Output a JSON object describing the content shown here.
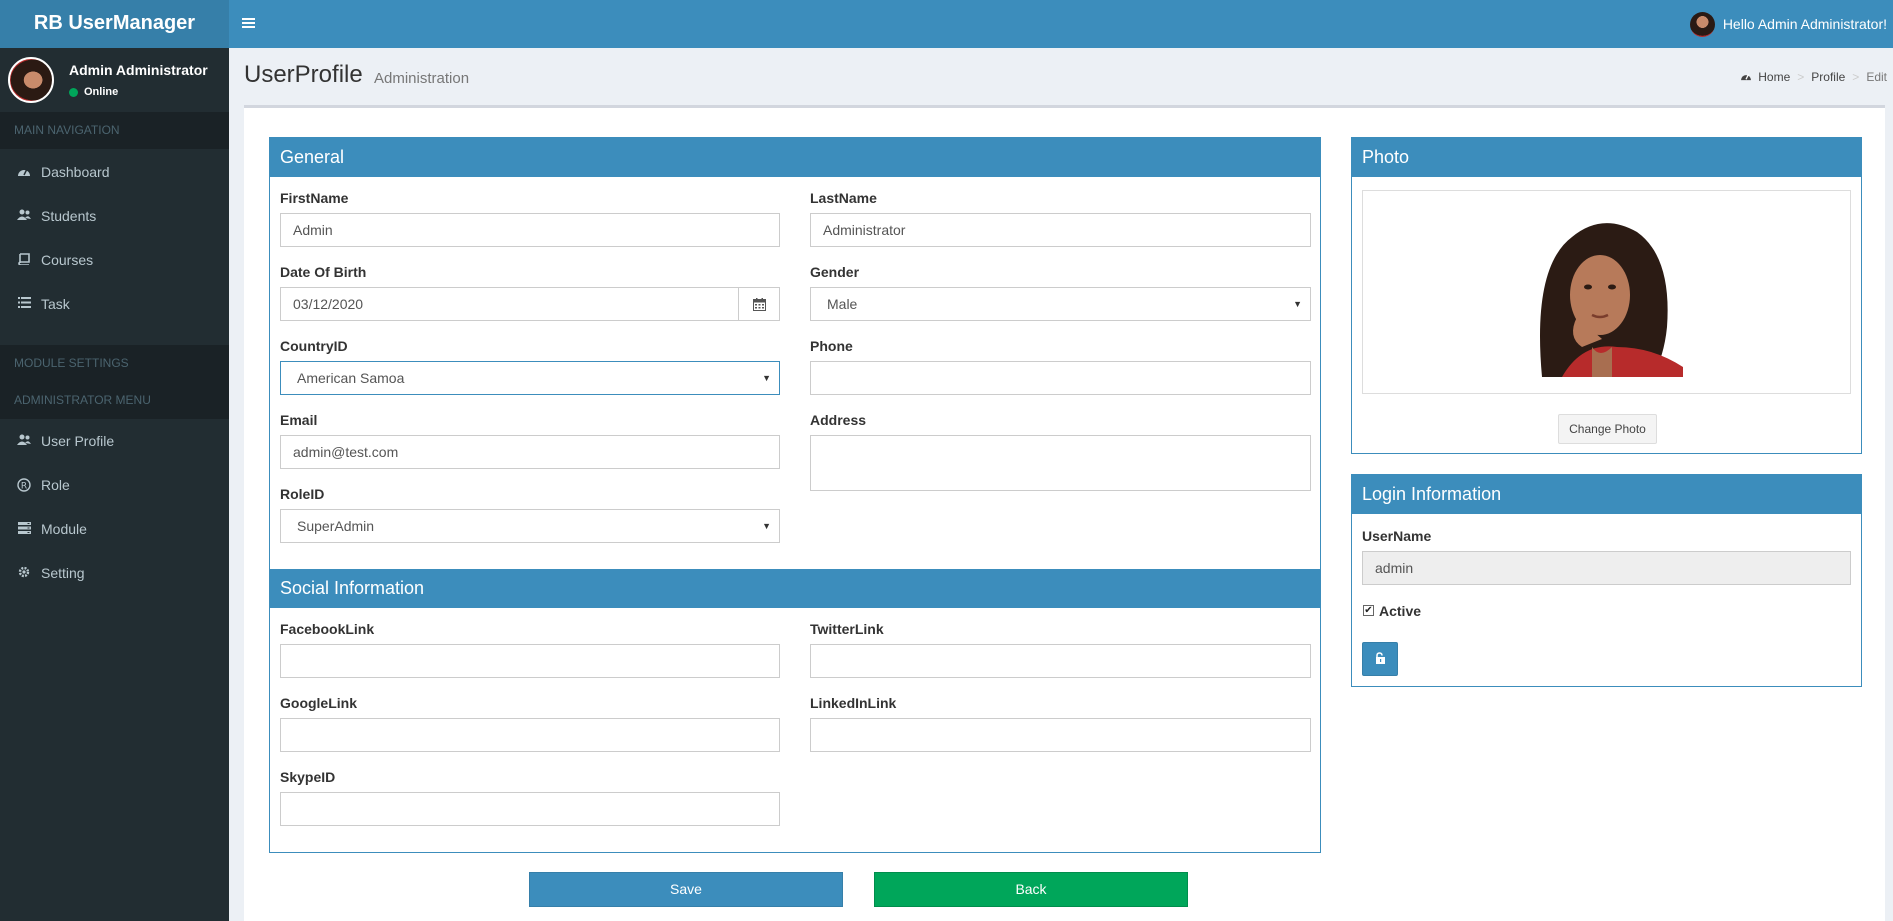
{
  "app": {
    "title": "RB UserManager",
    "greeting": "Hello Admin Administrator!"
  },
  "sidebar": {
    "user_name": "Admin Administrator",
    "user_status": "Online",
    "main_nav_header": "MAIN NAVIGATION",
    "main_items": [
      {
        "label": "Dashboard",
        "icon": "dashboard-icon"
      },
      {
        "label": "Students",
        "icon": "users-icon"
      },
      {
        "label": "Courses",
        "icon": "book-icon"
      },
      {
        "label": "Task",
        "icon": "list-icon"
      }
    ],
    "module_settings_header": "MODULE SETTINGS",
    "admin_menu_header": "ADMINISTRATOR MENU",
    "admin_items": [
      {
        "label": "User Profile",
        "icon": "users-icon"
      },
      {
        "label": "Role",
        "icon": "registered-icon"
      },
      {
        "label": "Module",
        "icon": "server-icon"
      },
      {
        "label": "Setting",
        "icon": "gear-icon"
      }
    ]
  },
  "page": {
    "title": "UserProfile",
    "subtitle": "Administration",
    "breadcrumb": [
      "Home",
      "Profile",
      "Edit"
    ]
  },
  "general": {
    "title": "General",
    "firstname_label": "FirstName",
    "firstname_value": "Admin",
    "lastname_label": "LastName",
    "lastname_value": "Administrator",
    "dob_label": "Date Of Birth",
    "dob_value": "03/12/2020",
    "gender_label": "Gender",
    "gender_value": "Male",
    "country_label": "CountryID",
    "country_value": "American Samoa",
    "phone_label": "Phone",
    "phone_value": "",
    "email_label": "Email",
    "email_value": "admin@test.com",
    "address_label": "Address",
    "address_value": "",
    "role_label": "RoleID",
    "role_value": "SuperAdmin"
  },
  "social": {
    "title": "Social Information",
    "facebook_label": "FacebookLink",
    "facebook_value": "",
    "twitter_label": "TwitterLink",
    "twitter_value": "",
    "google_label": "GoogleLink",
    "google_value": "",
    "linkedin_label": "LinkedInLink",
    "linkedin_value": "",
    "skype_label": "SkypeID",
    "skype_value": ""
  },
  "photo": {
    "title": "Photo",
    "change_label": "Change Photo"
  },
  "login": {
    "title": "Login Information",
    "username_label": "UserName",
    "username_value": "admin",
    "active_label": "Active",
    "active_checked": true
  },
  "actions": {
    "save_label": "Save",
    "back_label": "Back"
  },
  "colors": {
    "primary": "#3c8dbc",
    "success": "#00a65a",
    "sidebar": "#222d32"
  }
}
